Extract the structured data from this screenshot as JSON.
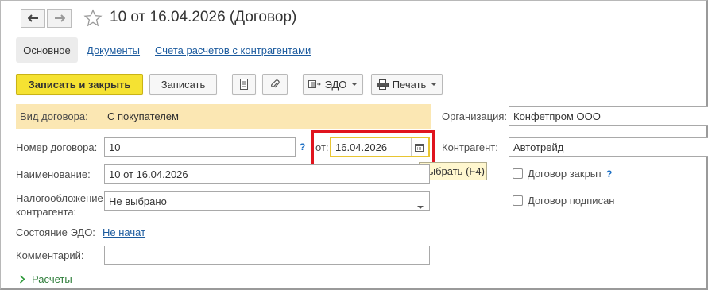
{
  "header": {
    "title": "10 от 16.04.2026 (Договор)"
  },
  "tabs": [
    {
      "label": "Основное"
    },
    {
      "label": "Документы"
    },
    {
      "label": "Счета расчетов с контрагентами"
    }
  ],
  "toolbar": {
    "save_close_label": "Записать и закрыть",
    "save_label": "Записать",
    "edo_label": "ЭДО",
    "print_label": "Печать"
  },
  "form": {
    "contract_type_label": "Вид договора:",
    "contract_type_value": "С покупателем",
    "number_label": "Номер договора:",
    "number_value": "10",
    "help_mark": "?",
    "date_label": "от:",
    "date_value": "16.04.2026",
    "name_label": "Наименование:",
    "name_value": "10 от 16.04.2026",
    "tax_label_line1": "Налогообложение",
    "tax_label_line2": "контрагента:",
    "tax_value": "Не выбрано",
    "edo_state_label": "Состояние ЭДО:",
    "edo_state_value": "Не начат",
    "comment_label": "Комментарий:",
    "comment_value": "",
    "org_label": "Организация:",
    "org_value": "Конфетпром ООО",
    "counterparty_label": "Контрагент:",
    "counterparty_value": "Автотрейд",
    "contract_closed_label": "Договор закрыт",
    "contract_signed_label": "Договор подписан",
    "settlements_label": "Расчеты"
  },
  "tooltip": {
    "text": "Выбрать (F4)"
  },
  "colors": {
    "primary_button": "#f5e232",
    "highlight_row": "#fbe7b3",
    "link": "#1c5b9e",
    "annotation_box": "#e0141e",
    "tooltip_bg": "#fff7cf",
    "settlements_chevron": "#2e9a3a"
  },
  "icons": {
    "back": "arrow-left-icon",
    "forward": "arrow-right-icon",
    "favorite": "star-icon",
    "list": "list-icon",
    "attach": "paperclip-icon",
    "edo": "edo-icon",
    "print": "printer-icon",
    "calendar": "calendar-icon",
    "dropdown": "chevron-down-icon",
    "expand": "chevron-right-icon"
  }
}
